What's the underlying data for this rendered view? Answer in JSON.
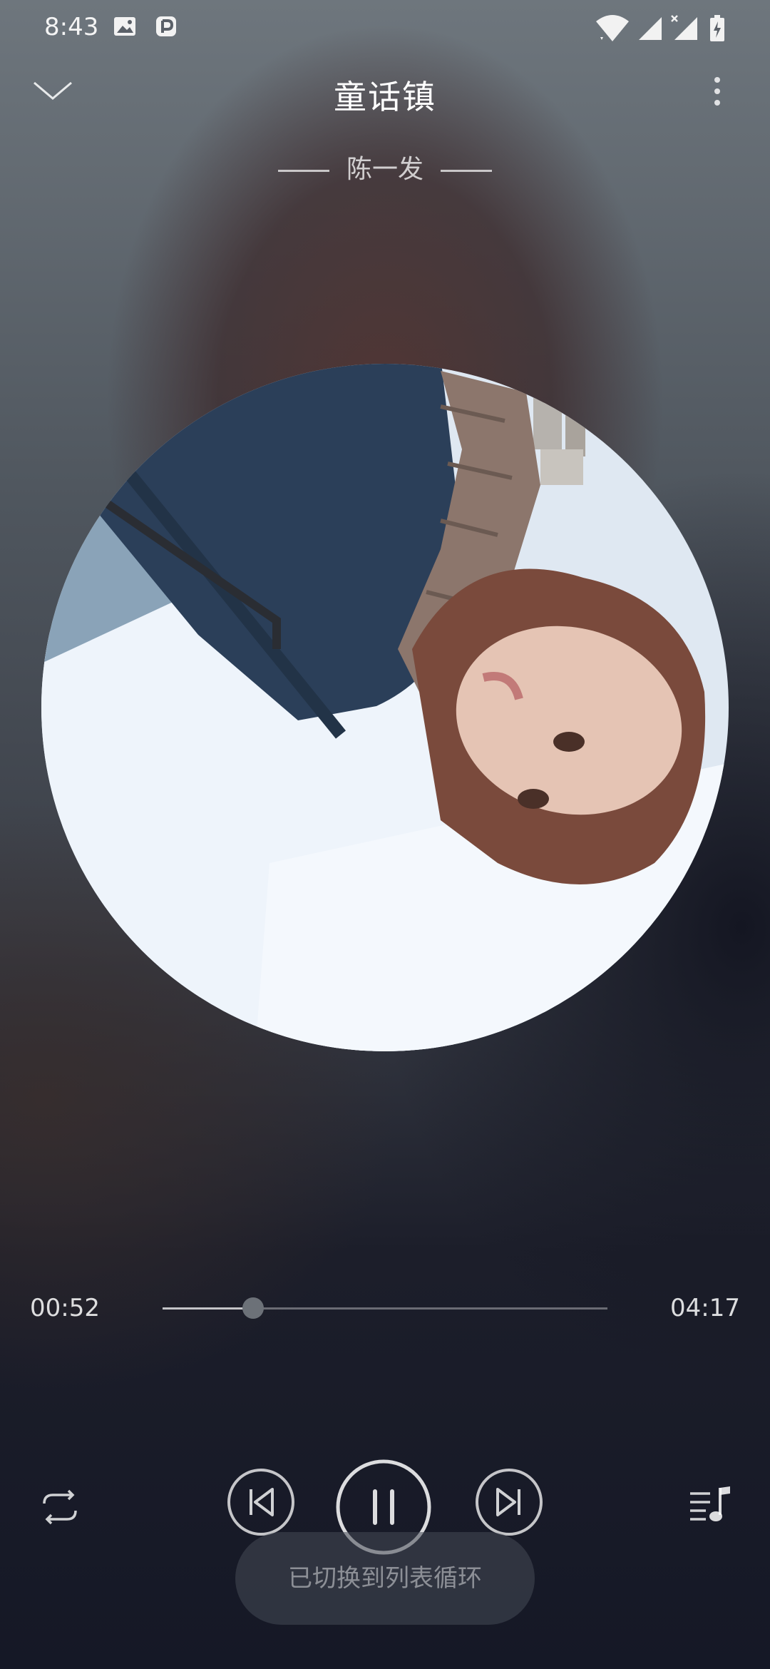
{
  "status_bar": {
    "time": "8:43",
    "icons": [
      "image-icon",
      "parking-icon",
      "wifi-icon",
      "signal-icon",
      "signal-x-icon",
      "battery-charging-icon"
    ]
  },
  "header": {
    "song_title": "童话镇",
    "artist": "陈一发",
    "collapse_icon": "chevron-down-icon",
    "more_icon": "more-vertical-icon"
  },
  "player": {
    "elapsed": "00:52",
    "duration": "04:17",
    "progress_fraction": 0.203
  },
  "controls": {
    "repeat_icon": "repeat-list-icon",
    "prev_icon": "skip-previous-icon",
    "play_pause_icon": "pause-icon",
    "next_icon": "skip-next-icon",
    "playlist_icon": "playlist-icon"
  },
  "toast": {
    "message": "已切换到列表循环"
  }
}
